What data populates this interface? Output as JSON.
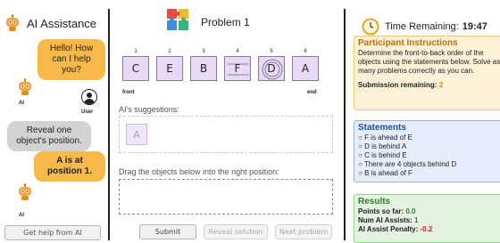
{
  "chat": {
    "title": "AI Assistance",
    "messages": [
      {
        "from": "ai",
        "text": "Hello! How can I help you?"
      },
      {
        "from": "user",
        "text": "Reveal one object's position."
      },
      {
        "from": "ai",
        "text": "A is at position 1."
      }
    ],
    "ai_label": "AI",
    "user_label": "User",
    "help_button": "Get help from AI"
  },
  "problem": {
    "title": "Problem 1",
    "positions": [
      "1",
      "2",
      "3",
      "4",
      "5",
      "6"
    ],
    "objects": [
      "C",
      "E",
      "B",
      "F",
      "D",
      "A"
    ],
    "front_label": "front",
    "end_label": "end",
    "suggestions_label": "AI's suggestions:",
    "suggestions": [
      "A"
    ],
    "drag_label": "Drag the objects below into the right position:",
    "buttons": {
      "submit": "Submit",
      "reveal": "Reveal solution",
      "next": "Next problem"
    }
  },
  "sidebar": {
    "timer_label": "Time Remaining:",
    "timer_value": "19:47",
    "instructions": {
      "title": "Participant Instructions",
      "text": "Determine the front-to-back order of the objects using the statements below. Solve as many problems correctly as you can.",
      "submission_label": "Submission remaining",
      "submission_value": "2"
    },
    "statements": {
      "title": "Statements",
      "items": [
        "F is ahead of E",
        "D is behind A",
        "C is behind E",
        "There are 4 objects behind D",
        "B is ahead of F"
      ]
    },
    "results": {
      "title": "Results",
      "points_label": "Points so far",
      "points_value": "0.0",
      "assists_label": "Num AI Assists",
      "assists_value": "1",
      "penalty_label": "AI Assist Penalty",
      "penalty_value": "-0.2"
    }
  }
}
